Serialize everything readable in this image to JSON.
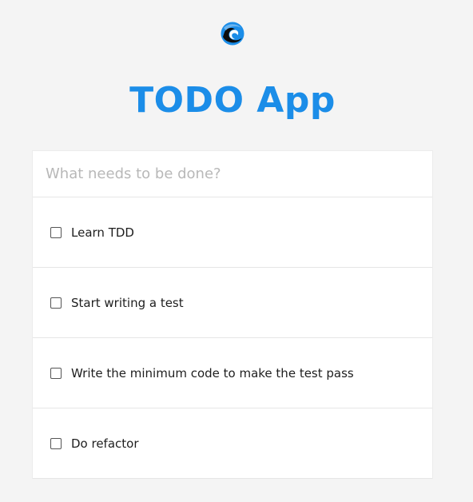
{
  "app": {
    "title": "TODO App",
    "accent_color": "#1b8de8",
    "logo_icon": "wave-logo-icon"
  },
  "new_todo": {
    "placeholder": "What needs to be done?",
    "value": ""
  },
  "todos": [
    {
      "label": "Learn TDD",
      "completed": false
    },
    {
      "label": "Start writing a test",
      "completed": false
    },
    {
      "label": "Write the minimum code to make the test pass",
      "completed": false
    },
    {
      "label": "Do refactor",
      "completed": false
    }
  ]
}
